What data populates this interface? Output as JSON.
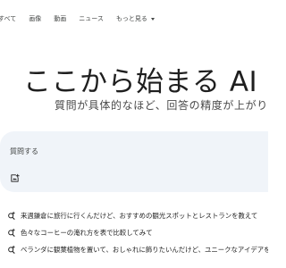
{
  "nav": {
    "items": [
      {
        "label": "すべて"
      },
      {
        "label": "画像"
      },
      {
        "label": "動画"
      },
      {
        "label": "ニュース"
      },
      {
        "label": "もっと見る"
      }
    ]
  },
  "hero": {
    "title": "ここから始まる AI モード",
    "subtitle": "質問が具体的なほど、回答の精度が上がります"
  },
  "input": {
    "placeholder": "質問する"
  },
  "suggestions": [
    {
      "text": "来週鎌倉に旅行に行くんだけど、おすすめの観光スポットとレストランを教えて"
    },
    {
      "text": "色々なコーヒーの淹れ方を表で比較してみて"
    },
    {
      "text": "ベランダに観葉植物を置いて、おしゃれに飾りたいんだけど、ユニークなアイデアを教えて"
    }
  ],
  "colors": {
    "input_background": "#f0f4f9",
    "text_primary": "#1f1f1f",
    "text_secondary": "#444746"
  }
}
